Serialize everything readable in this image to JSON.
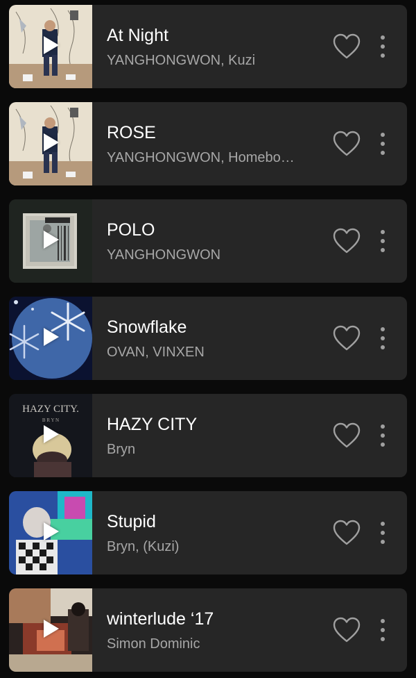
{
  "tracks": [
    {
      "title": "At Night",
      "artist": "YANGHONGWON, Kuzi",
      "cover_icon": "album-cover-at-night"
    },
    {
      "title": "ROSE",
      "artist": "YANGHONGWON, Homebo…",
      "cover_icon": "album-cover-rose"
    },
    {
      "title": "POLO",
      "artist": "YANGHONGWON",
      "cover_icon": "album-cover-polo"
    },
    {
      "title": "Snowflake",
      "artist": "OVAN, VINXEN",
      "cover_icon": "album-cover-snowflake"
    },
    {
      "title": "HAZY CITY",
      "artist": "Bryn",
      "cover_icon": "album-cover-hazy-city",
      "cover_text": "HAZY CITY.",
      "cover_subtext": "B R Y N"
    },
    {
      "title": "Stupid",
      "artist": "Bryn, (Kuzi)",
      "cover_icon": "album-cover-stupid"
    },
    {
      "title": "winterlude ‘17",
      "artist": "Simon Dominic",
      "cover_icon": "album-cover-winterlude"
    }
  ],
  "icons": {
    "play": "play-icon",
    "like": "heart-outline-icon",
    "more": "more-vertical-icon"
  },
  "colors": {
    "background": "#0a0a0a",
    "card": "#262626",
    "title": "#ffffff",
    "artist": "#a7a7a7",
    "icon": "#a0a0a0"
  }
}
